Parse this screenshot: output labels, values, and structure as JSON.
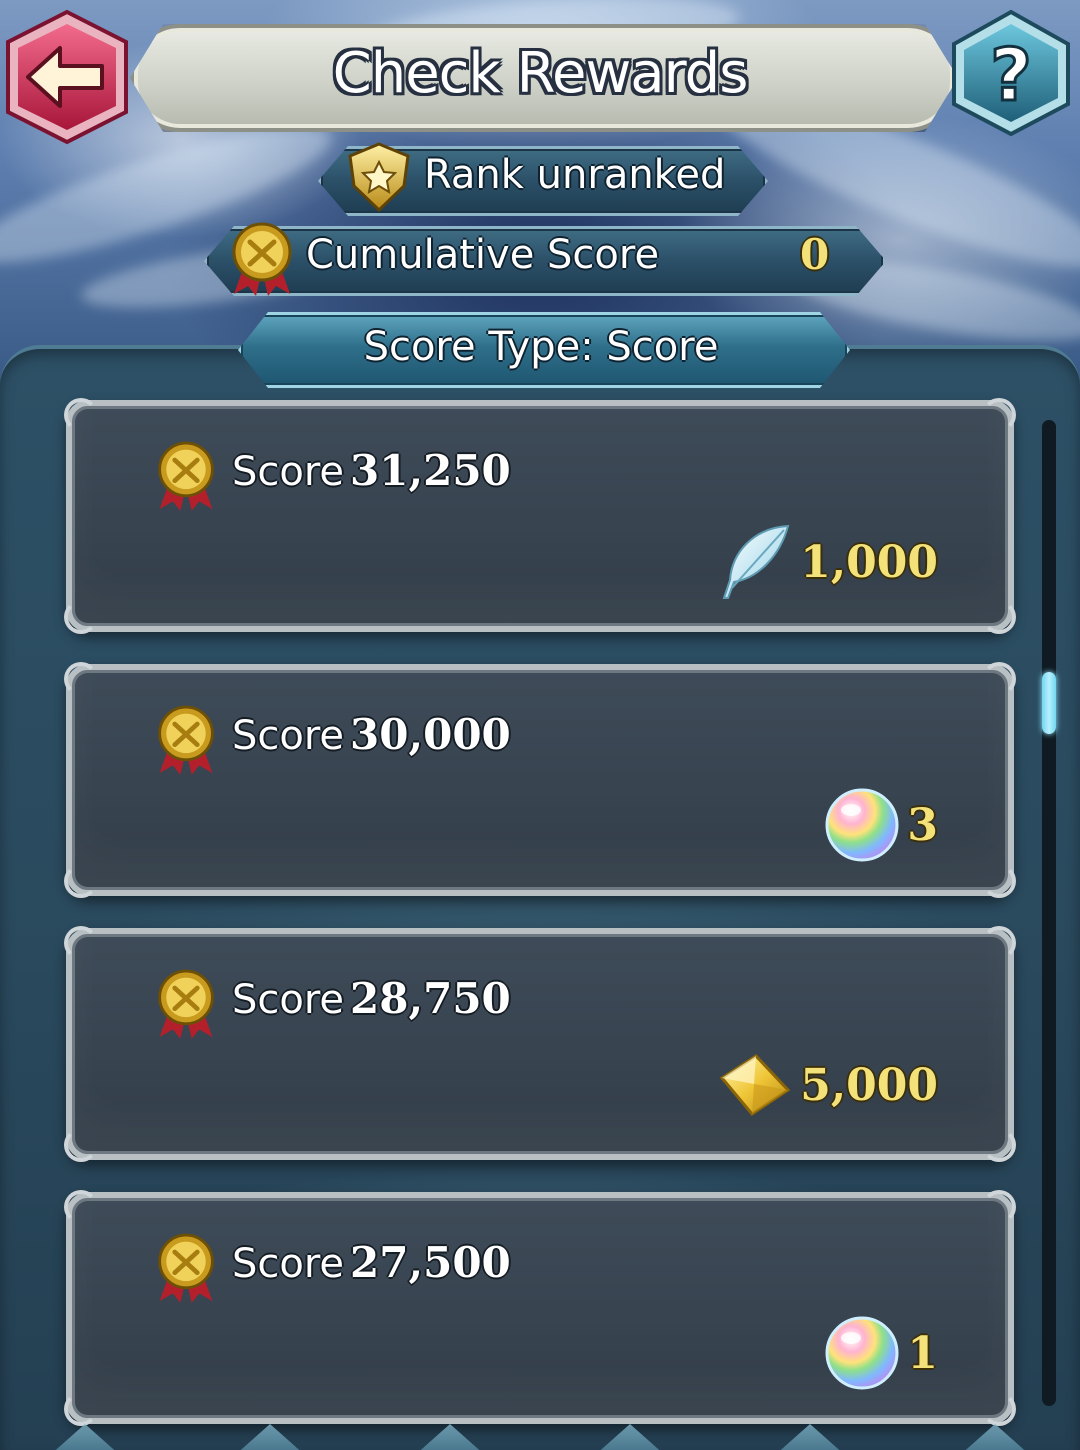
{
  "header": {
    "title": "Check Rewards",
    "back_icon": "back-arrow-icon",
    "help_icon": "help-question-icon"
  },
  "rank": {
    "label": "Rank",
    "value": "unranked"
  },
  "cumulative": {
    "label": "Cumulative Score",
    "value": "0"
  },
  "score_type": {
    "label": "Score Type: Score"
  },
  "rewards": [
    {
      "score_label": "Score",
      "score_value": "31,250",
      "reward_icon": "feather-icon",
      "reward_qty": "1,000"
    },
    {
      "score_label": "Score",
      "score_value": "30,000",
      "reward_icon": "orb-icon",
      "reward_qty": "3"
    },
    {
      "score_label": "Score",
      "score_value": "28,750",
      "reward_icon": "gold-crystal-icon",
      "reward_qty": "5,000"
    },
    {
      "score_label": "Score",
      "score_value": "27,500",
      "reward_icon": "orb-icon",
      "reward_qty": "1"
    }
  ],
  "colors": {
    "gold_text": "#f3e27a",
    "panel": "#2d5066",
    "card": "#37434f",
    "accent": "#6fd7f0"
  },
  "scroll": {
    "position_fraction": 0.26
  }
}
